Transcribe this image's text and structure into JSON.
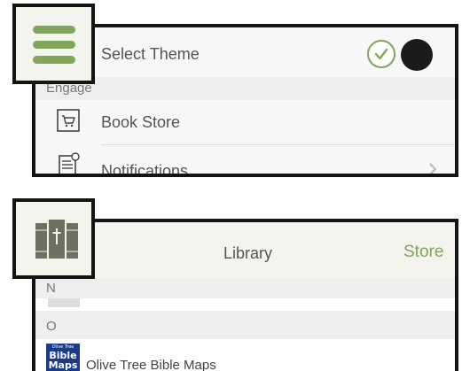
{
  "settings_panel": {
    "menu_icon": "hamburger-menu-icon",
    "select_theme_label": "Select Theme",
    "theme_options": [
      "light-theme-check",
      "dark-theme"
    ],
    "section_engage": "Engage",
    "book_store_label": "Book Store",
    "notifications_label": "Notifications",
    "accent": "#7fa65a"
  },
  "library_panel": {
    "library_icon": "books-icon",
    "title": "Library",
    "store_link": "Store",
    "section_n": "N",
    "section_o": "O",
    "book_cover_text": {
      "top": "Olive Tree",
      "line1": "Bible",
      "line2": "Maps"
    },
    "book_title": "Olive Tree Bible Maps"
  }
}
